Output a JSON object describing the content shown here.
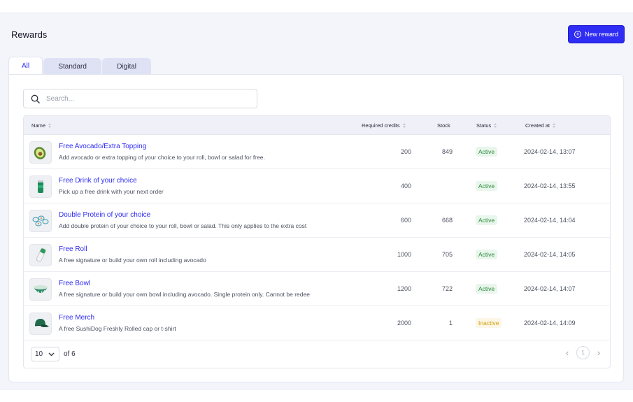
{
  "header": {
    "title": "Rewards",
    "new_button_label": "New reward"
  },
  "tabs": [
    {
      "label": "All",
      "active": true
    },
    {
      "label": "Standard",
      "active": false
    },
    {
      "label": "Digital",
      "active": false
    }
  ],
  "search": {
    "placeholder": "Search...",
    "value": ""
  },
  "table": {
    "columns": {
      "name": "Name",
      "credits": "Required credits",
      "stock": "Stock",
      "status": "Status",
      "created": "Created at"
    },
    "rows": [
      {
        "icon": "avocado-icon",
        "name": "Free Avocado/Extra Topping",
        "description": "Add avocado or extra topping of your choice to your roll, bowl or salad for free.",
        "credits": "200",
        "stock": "849",
        "status": "Active",
        "created": "2024-02-14, 13:07"
      },
      {
        "icon": "drink-can-icon",
        "name": "Free Drink of your choice",
        "description": "Pick up a free drink with your next order",
        "credits": "400",
        "stock": "",
        "status": "Active",
        "created": "2024-02-14, 13:55"
      },
      {
        "icon": "protein-icon",
        "name": "Double Protein of your choice",
        "description": "Add double protein of your choice to your roll, bowl or salad. This only applies to the extra cost",
        "credits": "600",
        "stock": "668",
        "status": "Active",
        "created": "2024-02-14, 14:04"
      },
      {
        "icon": "roll-icon",
        "name": "Free Roll",
        "description": "A free signature or build your own roll including avocado",
        "credits": "1000",
        "stock": "705",
        "status": "Active",
        "created": "2024-02-14, 14:05"
      },
      {
        "icon": "bowl-icon",
        "name": "Free Bowl",
        "description": "A free signature or build your own bowl including avocado. Single protein only. Cannot be redee",
        "credits": "1200",
        "stock": "722",
        "status": "Active",
        "created": "2024-02-14, 14:07"
      },
      {
        "icon": "cap-icon",
        "name": "Free Merch",
        "description": "A free SushiDog Freshly Rolled cap or t-shirt",
        "credits": "2000",
        "stock": "1",
        "status": "Inactive",
        "created": "2024-02-14, 14:09"
      }
    ]
  },
  "pagination": {
    "per_page": "10",
    "of_text": "of 6",
    "current_page": "1"
  },
  "colors": {
    "accent": "#2f2cf4",
    "active": "#2a8a3a",
    "inactive": "#d4a10a"
  }
}
